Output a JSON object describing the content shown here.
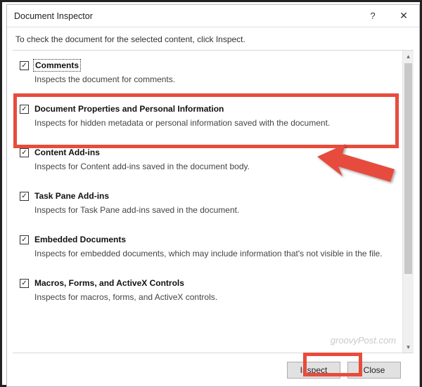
{
  "dialog": {
    "title": "Document Inspector",
    "instruction": "To check the document for the selected content, click Inspect."
  },
  "items": [
    {
      "label": "Comments",
      "desc": "Inspects the document for comments.",
      "checked": true,
      "focused": true
    },
    {
      "label": "Document Properties and Personal Information",
      "desc": "Inspects for hidden metadata or personal information saved with the document.",
      "checked": true,
      "focused": false
    },
    {
      "label": "Content Add-ins",
      "desc": "Inspects for Content add-ins saved in the document body.",
      "checked": true,
      "focused": false
    },
    {
      "label": "Task Pane Add-ins",
      "desc": "Inspects for Task Pane add-ins saved in the document.",
      "checked": true,
      "focused": false
    },
    {
      "label": "Embedded Documents",
      "desc": "Inspects for embedded documents, which may include information that's not visible in the file.",
      "checked": true,
      "focused": false
    },
    {
      "label": "Macros, Forms, and ActiveX Controls",
      "desc": "Inspects for macros, forms, and ActiveX controls.",
      "checked": true,
      "focused": false
    }
  ],
  "footer": {
    "inspect": "Inspect",
    "close": "Close"
  },
  "watermark": "groovyPost.com"
}
